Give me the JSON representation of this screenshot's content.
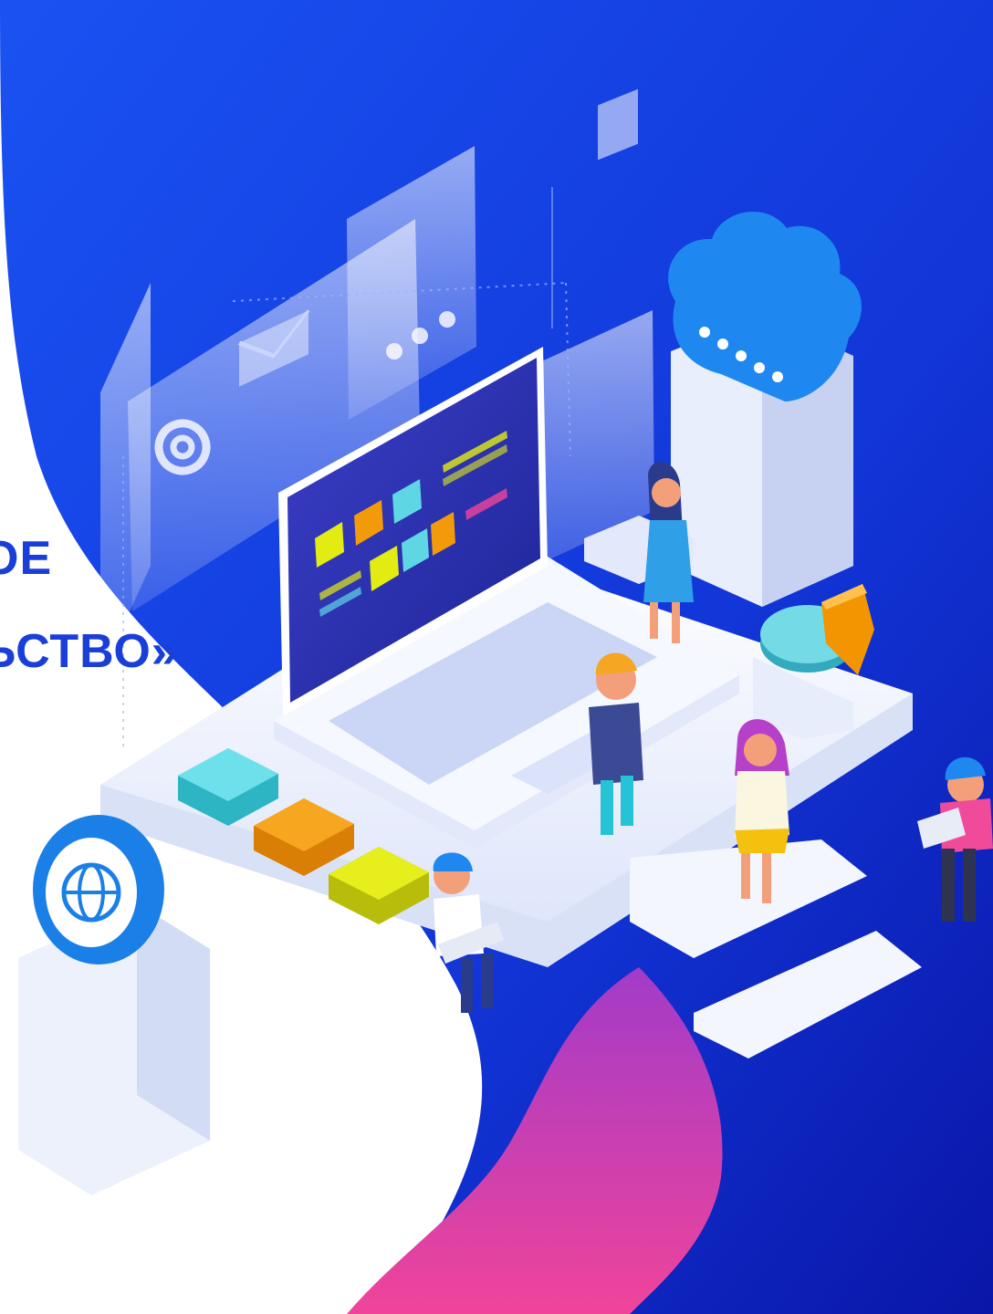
{
  "headline": {
    "line1": "ОЕ",
    "line2": "ЬСТВО»"
  },
  "colors": {
    "brand_blue": "#1340e6",
    "deep_blue": "#0a1db8",
    "headline_blue": "#1a3fd8",
    "pink": "#e43b92",
    "teal": "#5fd6e4",
    "orange": "#f39a0b",
    "yellow": "#e3ec12",
    "cloud": "#1e88f0"
  },
  "icons": [
    "at-sign-icon",
    "envelope-icon",
    "cloud-icon",
    "globe-icon",
    "pie-chart-icon",
    "laptop-icon"
  ]
}
